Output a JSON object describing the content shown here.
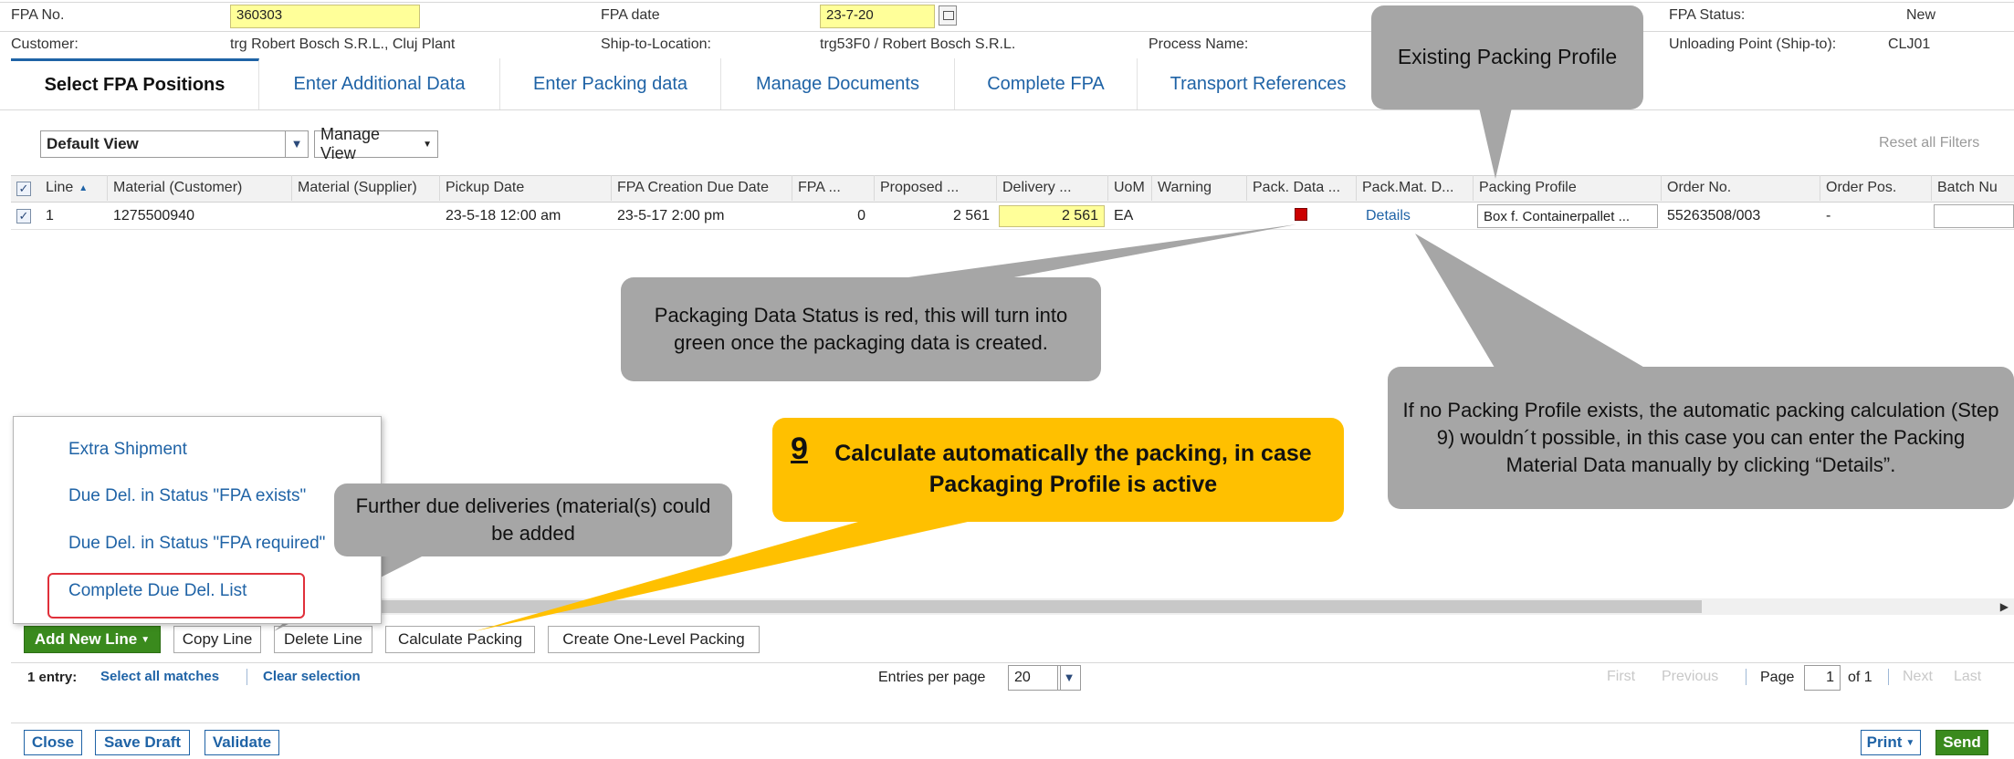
{
  "header": {
    "fpa_no_label": "FPA No.",
    "fpa_no_value": "360303",
    "fpa_date_label": "FPA date",
    "fpa_date_value": "23-7-20",
    "fpa_status_label": "FPA Status:",
    "fpa_status_value": "New",
    "customer_label": "Customer:",
    "customer_value": "trg Robert Bosch S.R.L., Cluj Plant",
    "ship_to_label": "Ship-to-Location:",
    "ship_to_value": "trg53F0 / Robert Bosch S.R.L.",
    "process_name_label": "Process Name:",
    "unloading_point_label": "Unloading Point (Ship-to):",
    "unloading_point_value": "CLJ01"
  },
  "tabs": [
    {
      "label": "Select FPA Positions",
      "active": true
    },
    {
      "label": "Enter Additional Data",
      "active": false
    },
    {
      "label": "Enter Packing data",
      "active": false
    },
    {
      "label": "Manage Documents",
      "active": false
    },
    {
      "label": "Complete FPA",
      "active": false
    },
    {
      "label": "Transport References",
      "active": false
    }
  ],
  "view": {
    "selected_view": "Default View",
    "manage_view_label": "Manage View",
    "reset_filters_label": "Reset all Filters"
  },
  "table": {
    "columns": [
      "Line",
      "Material (Customer)",
      "Material (Supplier)",
      "Pickup Date",
      "FPA Creation Due Date",
      "FPA ...",
      "Proposed ...",
      "Delivery ...",
      "UoM",
      "Warning",
      "Pack. Data ...",
      "Pack.Mat. D...",
      "Packing Profile",
      "Order No.",
      "Order Pos.",
      "Batch Nu"
    ],
    "rows": [
      {
        "line": "1",
        "material_customer": "1275500940",
        "material_supplier": "",
        "pickup_date": "23-5-18 12:00 am",
        "fpa_creation_due_date": "23-5-17 2:00 pm",
        "fpa": "0",
        "proposed": "2 561",
        "delivery": "2 561",
        "uom": "EA",
        "warning": "",
        "pack_data_status": "red",
        "pack_mat_details": "Details",
        "packing_profile": "Box f. Containerpallet ...",
        "order_no": "55263508/003",
        "order_pos": "-",
        "batch_no": ""
      }
    ]
  },
  "dropdown_menu": {
    "items": [
      "Extra Shipment",
      "Due Del. in Status \"FPA exists\"",
      "Due Del. in Status \"FPA required\"",
      "Complete Due Del. List"
    ]
  },
  "toolbar": {
    "add_new_line": "Add New Line",
    "copy_line": "Copy Line",
    "delete_line": "Delete Line",
    "calculate_packing": "Calculate Packing",
    "create_one_level_packing": "Create One-Level Packing"
  },
  "pagination": {
    "entries_count": "1 entry:",
    "select_all": "Select all matches",
    "clear_selection": "Clear selection",
    "entries_per_page_label": "Entries per page",
    "entries_per_page_value": "20",
    "first": "First",
    "previous": "Previous",
    "page_label": "Page",
    "page_value": "1",
    "of_label": "of 1",
    "next": "Next",
    "last": "Last"
  },
  "footer": {
    "close": "Close",
    "save_draft": "Save Draft",
    "validate": "Validate",
    "print": "Print",
    "send": "Send"
  },
  "callouts": {
    "existing_profile": "Existing Packing Profile",
    "packaging_status": "Packaging Data Status is red, this will turn into green once the packaging data is created.",
    "no_profile": "If no Packing Profile exists, the automatic packing calculation (Step 9) wouldn´t possible, in this case you can enter the Packing Material Data manually by clicking “Details”.",
    "step_number": "9",
    "step_text": "Calculate automatically the packing, in case Packaging Profile is active",
    "further_deliveries": "Further due deliveries (material(s) could be added"
  },
  "colors": {
    "accent": "#1f63a6",
    "yellow_field": "#ffff99",
    "green_button": "#3a8a1d",
    "callout_grey": "#a6a6a6",
    "callout_orange": "#ffc000",
    "status_red": "#cc0000"
  }
}
